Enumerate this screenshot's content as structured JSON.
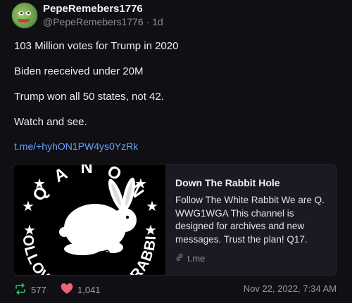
{
  "post": {
    "display_name": "PepeRemebers1776",
    "handle": "@PepeRemebers1776",
    "separator": "·",
    "age": "1d",
    "lines": [
      "103 Million votes for Trump in 2020",
      "Biden reeceived under 20M",
      "Trump won all 50 states, not 42.",
      "Watch and see."
    ],
    "link_text": "t.me/+hyhON1PW4ys0YzRk"
  },
  "card": {
    "title": "Down The Rabbit Hole",
    "description": "Follow The White Rabbit We are Q. WWG1WGA This channel is designed for archives and new messages. Trust the plan! Q17.",
    "domain": "t.me",
    "image_text_top": "Q A N O N",
    "image_text_bottom": "FOLLOW THE WHITE RABBIT"
  },
  "footer": {
    "reposts": "577",
    "likes": "1,041",
    "timestamp": "Nov 22, 2022, 7:34 AM"
  },
  "colors": {
    "background": "#0f0f14",
    "link": "#5fa3ff",
    "repost": "#2fb36b",
    "like": "#f0617a"
  }
}
